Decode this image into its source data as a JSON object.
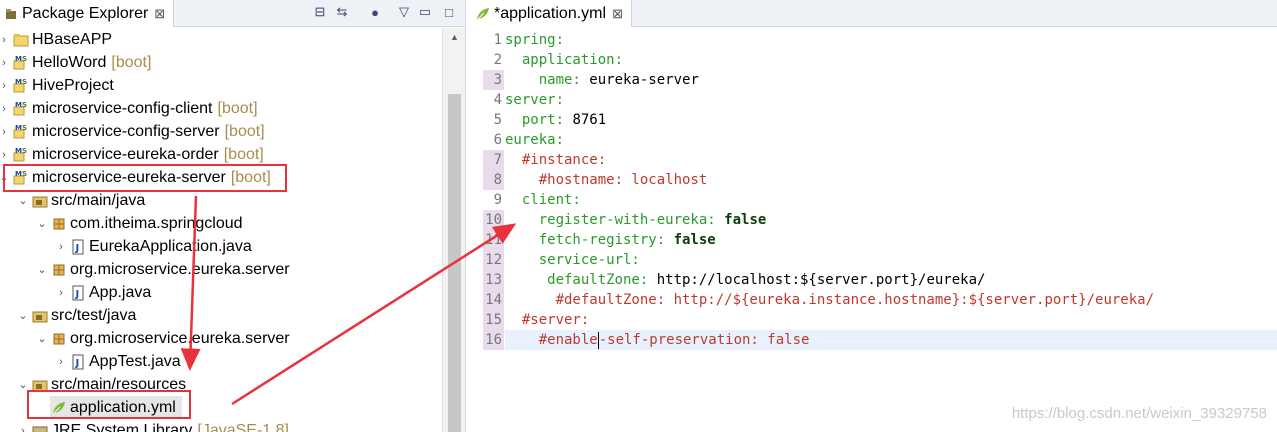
{
  "explorer": {
    "title": "Package Explorer",
    "close": "⊠",
    "toolbar": [
      {
        "icon": "collapse-all-icon",
        "glyph": "⊟"
      },
      {
        "icon": "link-with-editor-icon",
        "glyph": "⇆"
      },
      {
        "icon": "focus-icon",
        "glyph": "●"
      },
      {
        "icon": "view-menu-icon",
        "glyph": "▽"
      },
      {
        "icon": "minimize-icon",
        "glyph": "▭"
      },
      {
        "icon": "maximize-icon",
        "glyph": "□"
      }
    ],
    "tree": [
      {
        "label": "HBaseAPP",
        "boot": "",
        "twisty": "›",
        "icon": "project-folder-icon"
      },
      {
        "label": "HelloWord",
        "boot": "[boot]",
        "twisty": "›",
        "icon": "maven-project-icon"
      },
      {
        "label": "HiveProject",
        "boot": "",
        "twisty": "›",
        "icon": "maven-project-icon"
      },
      {
        "label": "microservice-config-client",
        "boot": "[boot]",
        "twisty": "›",
        "icon": "maven-project-icon"
      },
      {
        "label": "microservice-config-server",
        "boot": "[boot]",
        "twisty": "›",
        "icon": "maven-project-icon"
      },
      {
        "label": "microservice-eureka-order",
        "boot": "[boot]",
        "twisty": "›",
        "icon": "maven-project-icon"
      },
      {
        "label": "microservice-eureka-server",
        "boot": "[boot]",
        "twisty": "⌄",
        "icon": "maven-project-icon"
      },
      {
        "label": "src/main/java",
        "boot": "",
        "twisty": "⌄",
        "icon": "source-folder-icon"
      },
      {
        "label": "com.itheima.springcloud",
        "boot": "",
        "twisty": "⌄",
        "icon": "package-icon"
      },
      {
        "label": "EurekaApplication.java",
        "boot": "",
        "twisty": "›",
        "icon": "java-file-icon"
      },
      {
        "label": "org.microservice.eureka.server",
        "boot": "",
        "twisty": "⌄",
        "icon": "package-icon"
      },
      {
        "label": "App.java",
        "boot": "",
        "twisty": "›",
        "icon": "java-file-icon"
      },
      {
        "label": "src/test/java",
        "boot": "",
        "twisty": "⌄",
        "icon": "source-folder-icon"
      },
      {
        "label": "org.microservice.eureka.server",
        "boot": "",
        "twisty": "⌄",
        "icon": "package-icon"
      },
      {
        "label": "AppTest.java",
        "boot": "",
        "twisty": "›",
        "icon": "java-file-icon"
      },
      {
        "label": "src/main/resources",
        "boot": "",
        "twisty": "⌄",
        "icon": "source-folder-icon"
      },
      {
        "label": "application.yml",
        "boot": "",
        "twisty": "",
        "icon": "yaml-file-icon"
      },
      {
        "label": "JRE System Library",
        "boot": "[JavaSE-1.8]",
        "twisty": "›",
        "icon": "library-icon"
      }
    ]
  },
  "editor": {
    "tab_title": "*application.yml",
    "close": "⊠",
    "line_numbers": [
      "1",
      "2",
      "3",
      "4",
      "5",
      "6",
      "7",
      "8",
      "9",
      "10",
      "11",
      "12",
      "13",
      "14",
      "15",
      "16"
    ],
    "lines": [
      [
        {
          "t": "spring:",
          "s": "k"
        }
      ],
      [
        {
          "t": "  application:",
          "s": "k"
        }
      ],
      [
        {
          "t": "    name: ",
          "s": "k"
        },
        {
          "t": "eureka-server",
          "s": "v"
        }
      ],
      [
        {
          "t": "server:",
          "s": "k"
        }
      ],
      [
        {
          "t": "  port: ",
          "s": "k"
        },
        {
          "t": "8761",
          "s": "v"
        }
      ],
      [
        {
          "t": "eureka:",
          "s": "k"
        }
      ],
      [
        {
          "t": "  #instance:",
          "s": "c"
        }
      ],
      [
        {
          "t": "    #hostname: localhost",
          "s": "c"
        }
      ],
      [
        {
          "t": "  client:",
          "s": "k"
        }
      ],
      [
        {
          "t": "    register-with-eureka: ",
          "s": "k"
        },
        {
          "t": "false",
          "s": "b"
        }
      ],
      [
        {
          "t": "    fetch-registry: ",
          "s": "k"
        },
        {
          "t": "false",
          "s": "b"
        }
      ],
      [
        {
          "t": "    service-url:",
          "s": "k"
        }
      ],
      [
        {
          "t": "     defaultZone: ",
          "s": "k"
        },
        {
          "t": "http://localhost:${server.port}/eureka/",
          "s": "v"
        }
      ],
      [
        {
          "t": "      #defaultZone: http://${eureka.instance.hostname}:${server.port}/eureka/",
          "s": "c"
        }
      ],
      [
        {
          "t": "  #server:",
          "s": "c"
        }
      ],
      [
        {
          "t": "    #enable",
          "s": "c"
        },
        {
          "t": "",
          "s": "caret"
        },
        {
          "t": "-self-preservation: false",
          "s": "c"
        }
      ]
    ]
  },
  "watermark": "https://blog.csdn.net/weixin_39329758",
  "colors": {
    "highlight_box": "#e8323c",
    "arrow": "#e8323c",
    "boot": "#a88d4c"
  }
}
